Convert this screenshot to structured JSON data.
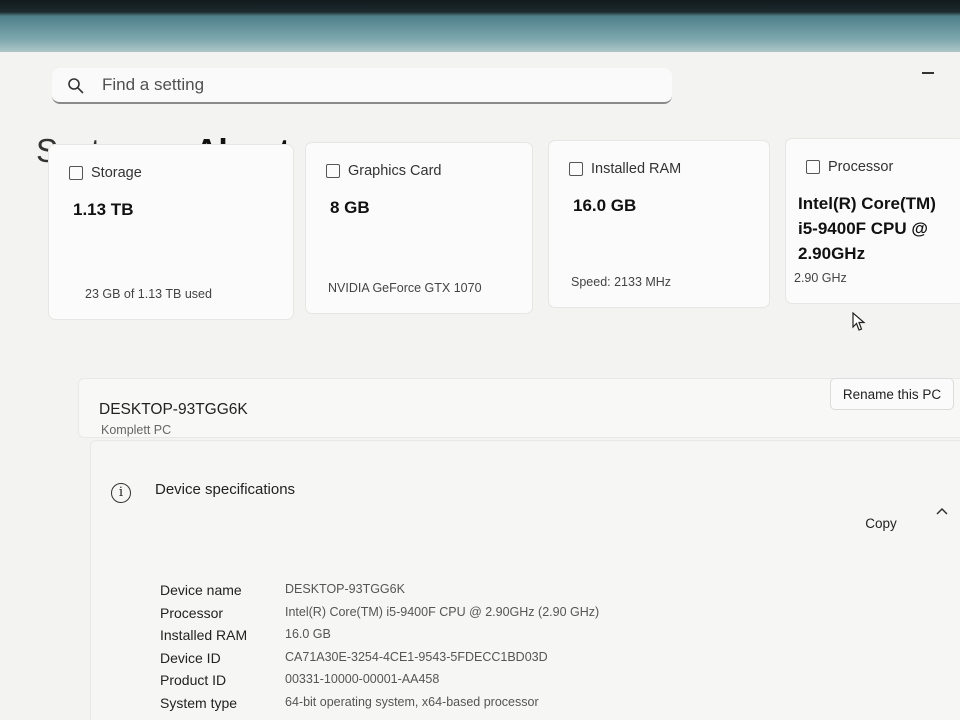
{
  "search": {
    "placeholder": "Find a setting"
  },
  "breadcrumb": {
    "parent": "System",
    "separator": "›",
    "current": "About"
  },
  "cards": {
    "storage": {
      "label": "Storage",
      "value": "1.13 TB",
      "footer": "23 GB of 1.13 TB used",
      "icon": "storage-icon"
    },
    "graphics": {
      "label": "Graphics Card",
      "value": "8 GB",
      "footer": "NVIDIA GeForce GTX 1070",
      "icon": "graphics-card-icon"
    },
    "ram": {
      "label": "Installed RAM",
      "value": "16.0 GB",
      "footer": "Speed: 2133 MHz",
      "icon": "memory-icon"
    },
    "processor": {
      "label": "Processor",
      "value_line1": "Intel(R) Core(TM)",
      "value_line2": "i5-9400F CPU @",
      "value_line3": "2.90GHz",
      "footer": "2.90 GHz",
      "icon": "processor-icon"
    }
  },
  "pc": {
    "name": "DESKTOP-93TGG6K",
    "model": "Komplett PC",
    "rename_label": "Rename this PC"
  },
  "device_specs": {
    "title": "Device specifications",
    "copy_label": "Copy",
    "rows": [
      {
        "label": "Device name",
        "value": "DESKTOP-93TGG6K"
      },
      {
        "label": "Processor",
        "value": "Intel(R) Core(TM) i5-9400F CPU @ 2.90GHz (2.90 GHz)"
      },
      {
        "label": "Installed RAM",
        "value": "16.0 GB"
      },
      {
        "label": "Device ID",
        "value": "CA71A30E-3254-4CE1-9543-5FDECC1BD03D"
      },
      {
        "label": "Product ID",
        "value": "00331-10000-00001-AA458"
      },
      {
        "label": "System type",
        "value": "64-bit operating system, x64-based processor"
      }
    ]
  }
}
